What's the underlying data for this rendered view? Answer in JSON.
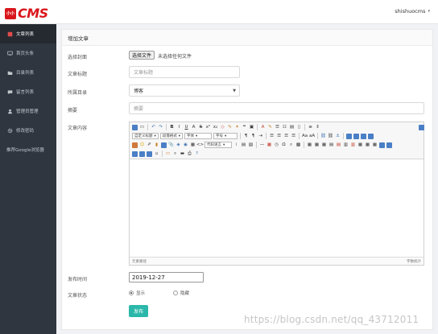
{
  "logo": {
    "badge": "小小",
    "text": "CMS"
  },
  "header": {
    "username": "shishuocms",
    "caret": "▾"
  },
  "sidebar": {
    "items": [
      {
        "label": "文章列表",
        "icon": "book-icon",
        "active": true
      },
      {
        "label": "首页头条",
        "icon": "monitor-icon",
        "active": false
      },
      {
        "label": "目录列表",
        "icon": "folder-icon",
        "active": false
      },
      {
        "label": "留言列表",
        "icon": "message-icon",
        "active": false
      },
      {
        "label": "管理员管理",
        "icon": "user-icon",
        "active": false
      },
      {
        "label": "修改密码",
        "icon": "gear-icon",
        "active": false
      },
      {
        "label": "推荐Google浏览器",
        "icon": "",
        "active": false
      }
    ]
  },
  "panel": {
    "title": "增加文章"
  },
  "form": {
    "cover_label": "选择封面",
    "file_button": "选择文件",
    "file_status": "未选择任何文件",
    "title_label": "文章标题",
    "title_placeholder": "文章标题",
    "folder_label": "所属目录",
    "folder_value": "博客",
    "summary_label": "摘要",
    "summary_placeholder": "摘要",
    "content_label": "文章内容",
    "time_label": "发布时间",
    "time_value": "2019-12-27",
    "status_label": "文章状态",
    "status_show": "显示",
    "status_hide": "隐藏",
    "submit": "发布"
  },
  "editor": {
    "selects": {
      "paragraph": "自定义标题",
      "format": "段落格式",
      "font": "字体",
      "size": "字号",
      "code": "代码语言"
    },
    "footer_left": "元素路径",
    "footer_right": "字数统计"
  },
  "watermark": "https://blog.csdn.net/qq_43712011"
}
